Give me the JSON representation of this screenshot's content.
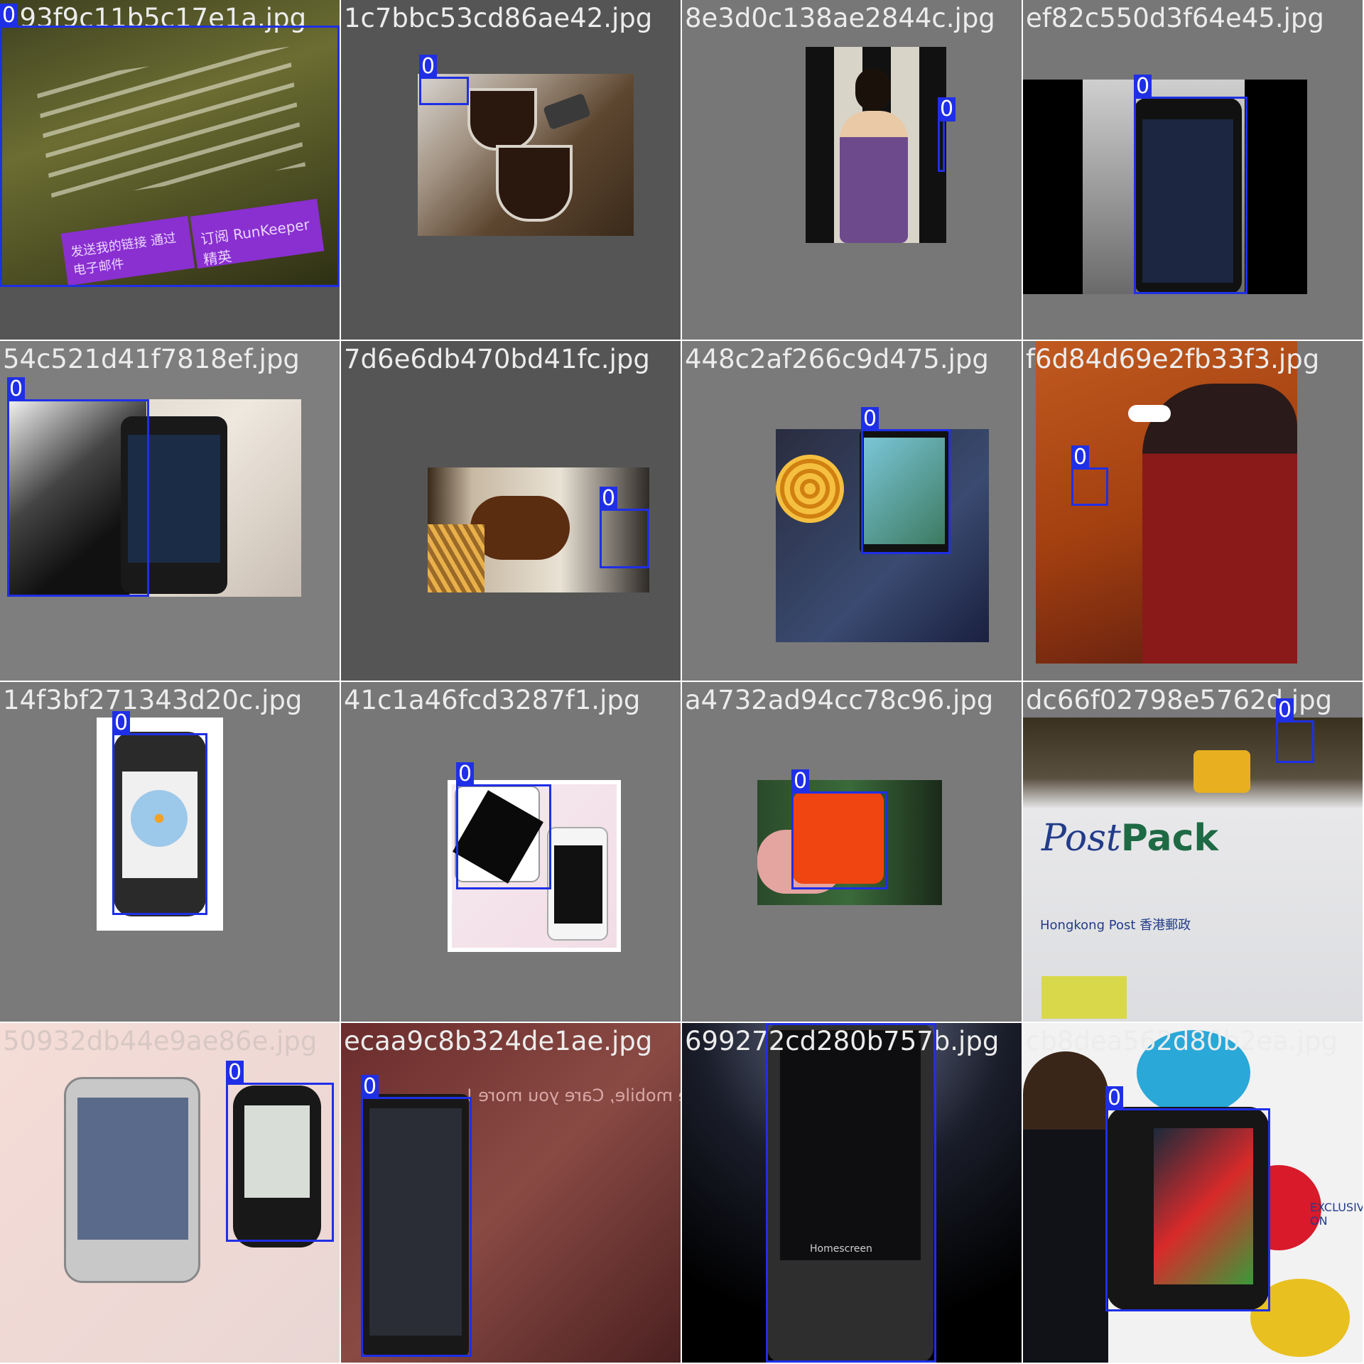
{
  "page": {
    "background": "#7a7a7a",
    "box_color": "#1f2fe6"
  },
  "tiles": [
    {
      "filename": "093f9c11b5c17e1a.jpg",
      "class_label": "0"
    },
    {
      "filename": "1c7bbc53cd86ae42.jpg",
      "class_label": "0"
    },
    {
      "filename": "8e3d0c138ae2844c.jpg",
      "class_label": "0"
    },
    {
      "filename": "ef82c550d3f64e45.jpg",
      "class_label": "0"
    },
    {
      "filename": "54c521d41f7818ef.jpg",
      "class_label": "0"
    },
    {
      "filename": "7d6e6db470bd41fc.jpg",
      "class_label": "0"
    },
    {
      "filename": "448c2af266c9d475.jpg",
      "class_label": "0"
    },
    {
      "filename": "f6d84d69e2fb33f3.jpg",
      "class_label": "0"
    },
    {
      "filename": "14f3bf271343d20c.jpg",
      "class_label": "0"
    },
    {
      "filename": "41c1a46fcd3287f1.jpg",
      "class_label": "0"
    },
    {
      "filename": "a4732ad94cc78c96.jpg",
      "class_label": "0"
    },
    {
      "filename": "dc66f02798e5762d.jpg",
      "class_label": "0"
    },
    {
      "filename": "50932db44e9ae86e.jpg",
      "class_label": "0",
      "class_label_2": "0"
    },
    {
      "filename": "ecaa9c8b324de1ae.jpg",
      "class_label": "0"
    },
    {
      "filename": "699272cd280b757b.jpg",
      "class_label": "0"
    },
    {
      "filename": "cb8dea562d80b2ea.jpg",
      "class_label": "0"
    }
  ],
  "photo_text": {
    "t0_button1": "订阅 RunKeeper 精英",
    "t0_button2": "发送我的链接 通过电子邮件",
    "t11_brand1": "Post",
    "t11_brand2": "Pack",
    "t11_hk": "Hongkong Post 香港郵政",
    "t13_slogan": "ere mobile, Care you more !",
    "t14_homescreen": "Homescreen",
    "t15_exclusive": "EXCLUSIVE ON"
  }
}
